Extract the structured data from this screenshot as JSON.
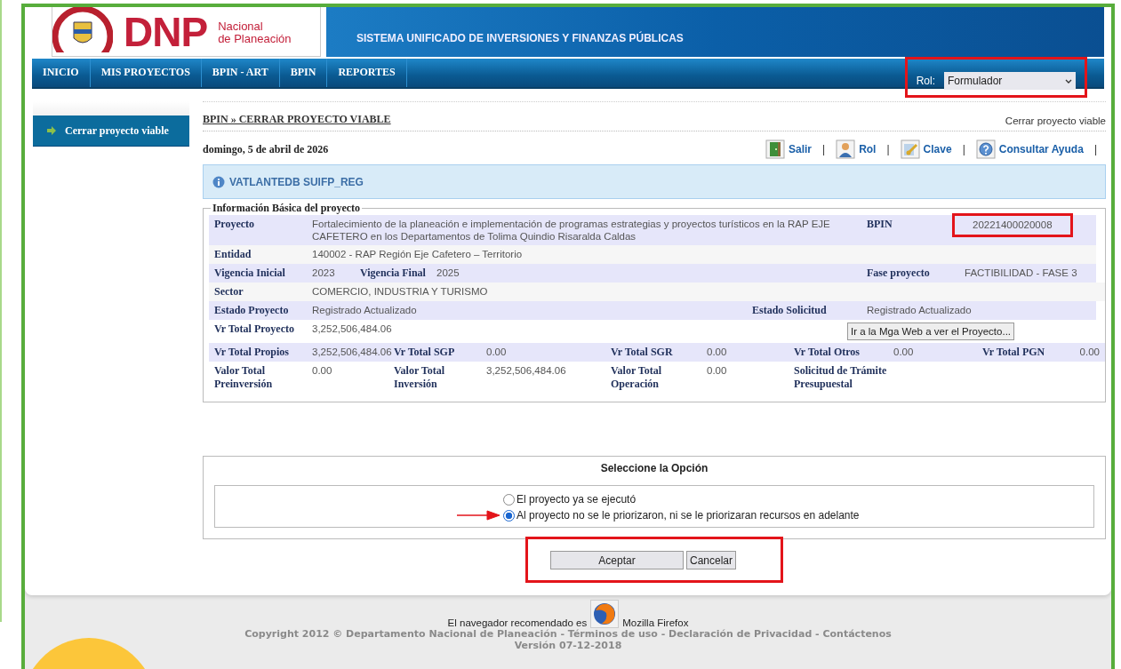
{
  "logo": {
    "acronym": "DNP",
    "name_lines": [
      "Nacional",
      "de Planeación"
    ]
  },
  "banner": {
    "subtitle": "SISTEMA UNIFICADO DE  INVERSIONES Y FINANZAS PÚBLICAS"
  },
  "nav": [
    {
      "label": "INICIO"
    },
    {
      "label": "MIS PROYECTOS"
    },
    {
      "label": "BPIN - ART"
    },
    {
      "label": "BPIN"
    },
    {
      "label": "REPORTES"
    }
  ],
  "role": {
    "label": "Rol:",
    "value": "Formulador",
    "highlighted": true
  },
  "sidebar": {
    "items": [
      {
        "label": "Cerrar proyecto viable",
        "selected": true
      }
    ]
  },
  "breadcrumb": "BPIN » CERRAR PROYECTO VIABLE",
  "page_title": "Cerrar proyecto viable",
  "date": "domingo, 5 de abril de 2026",
  "toolbar": [
    {
      "label": "Salir",
      "separator": "|"
    },
    {
      "label": "Rol",
      "separator": "|"
    },
    {
      "label": "Clave",
      "separator": "|"
    },
    {
      "label": "Consultar Ayuda",
      "separator": "|"
    }
  ],
  "notice": "VATLANTEDB SUIFP_REG",
  "info": {
    "legend": "Información Básica del proyecto",
    "rows": [
      {
        "fields": [
          {
            "label": "Proyecto",
            "value": "Fortalecimiento de la planeación e implementación de programas estrategias y proyectos turísticos en la RAP EJE CAFETERO en los Departamentos de Tolima Quindio Risaralda Caldas"
          },
          {
            "label": "BPIN",
            "value": "20221400020008",
            "highlighted": true
          }
        ]
      },
      {
        "fields": [
          {
            "label": "Entidad",
            "value": "140002 - RAP Región Eje Cafetero – Territorio"
          }
        ]
      },
      {
        "fields": [
          {
            "label": "Vigencia Inicial",
            "value": "2023"
          },
          {
            "label": "Vigencia Final",
            "value": "2025"
          },
          {
            "label": "Fase proyecto",
            "value": "FACTIBILIDAD - FASE 3"
          }
        ]
      },
      {
        "fields": [
          {
            "label": "Sector",
            "value": "COMERCIO, INDUSTRIA Y TURISMO"
          }
        ]
      },
      {
        "fields": [
          {
            "label": "Estado Proyecto",
            "value": "Registrado Actualizado"
          },
          {
            "label": "Estado Solicitud",
            "value": "Registrado Actualizado"
          }
        ]
      },
      {
        "fields": [
          {
            "label": "Vr Total Proyecto",
            "value": "3,252,506,484.06"
          }
        ],
        "button": "Ir a la Mga Web a ver el Proyecto..."
      },
      {
        "fields": [
          {
            "label": "Vr Total Propios",
            "value": "3,252,506,484.06"
          },
          {
            "label": "Vr Total SGP",
            "value": "0.00"
          },
          {
            "label": "Vr Total SGR",
            "value": "0.00"
          },
          {
            "label": "Vr Total Otros",
            "value": "0.00"
          },
          {
            "label": "Vr Total PGN",
            "value": "0.00"
          }
        ]
      },
      {
        "fields": [
          {
            "label": "Valor Total Preinversión",
            "value": "0.00"
          },
          {
            "label": "Valor Total Inversión",
            "value": "3,252,506,484.06"
          },
          {
            "label": "Valor Total Operación",
            "value": "0.00"
          },
          {
            "label": "Solicitud de Trámite Presupuestal"
          }
        ]
      }
    ]
  },
  "options": {
    "title": "Seleccione la Opción",
    "items": [
      {
        "label": "El proyecto ya se ejecutó",
        "selected": false,
        "arrow": false
      },
      {
        "label": "Al proyecto no se le priorizaron, ni se le priorizaran recursos en adelante",
        "selected": true,
        "arrow": true
      }
    ]
  },
  "actions": {
    "highlighted": true,
    "buttons": [
      {
        "label": "Aceptar"
      },
      {
        "label": "Cancelar"
      }
    ]
  },
  "footer": {
    "browser_text": "El navegador recomendado es",
    "browser_name": "Mozilla Firefox",
    "copyright": "Copyright 2012 © Departamento Nacional de Planeación - Términos de uso - Declaración de Privacidad - Contáctenos",
    "version": "Versión 07-12-2018"
  }
}
